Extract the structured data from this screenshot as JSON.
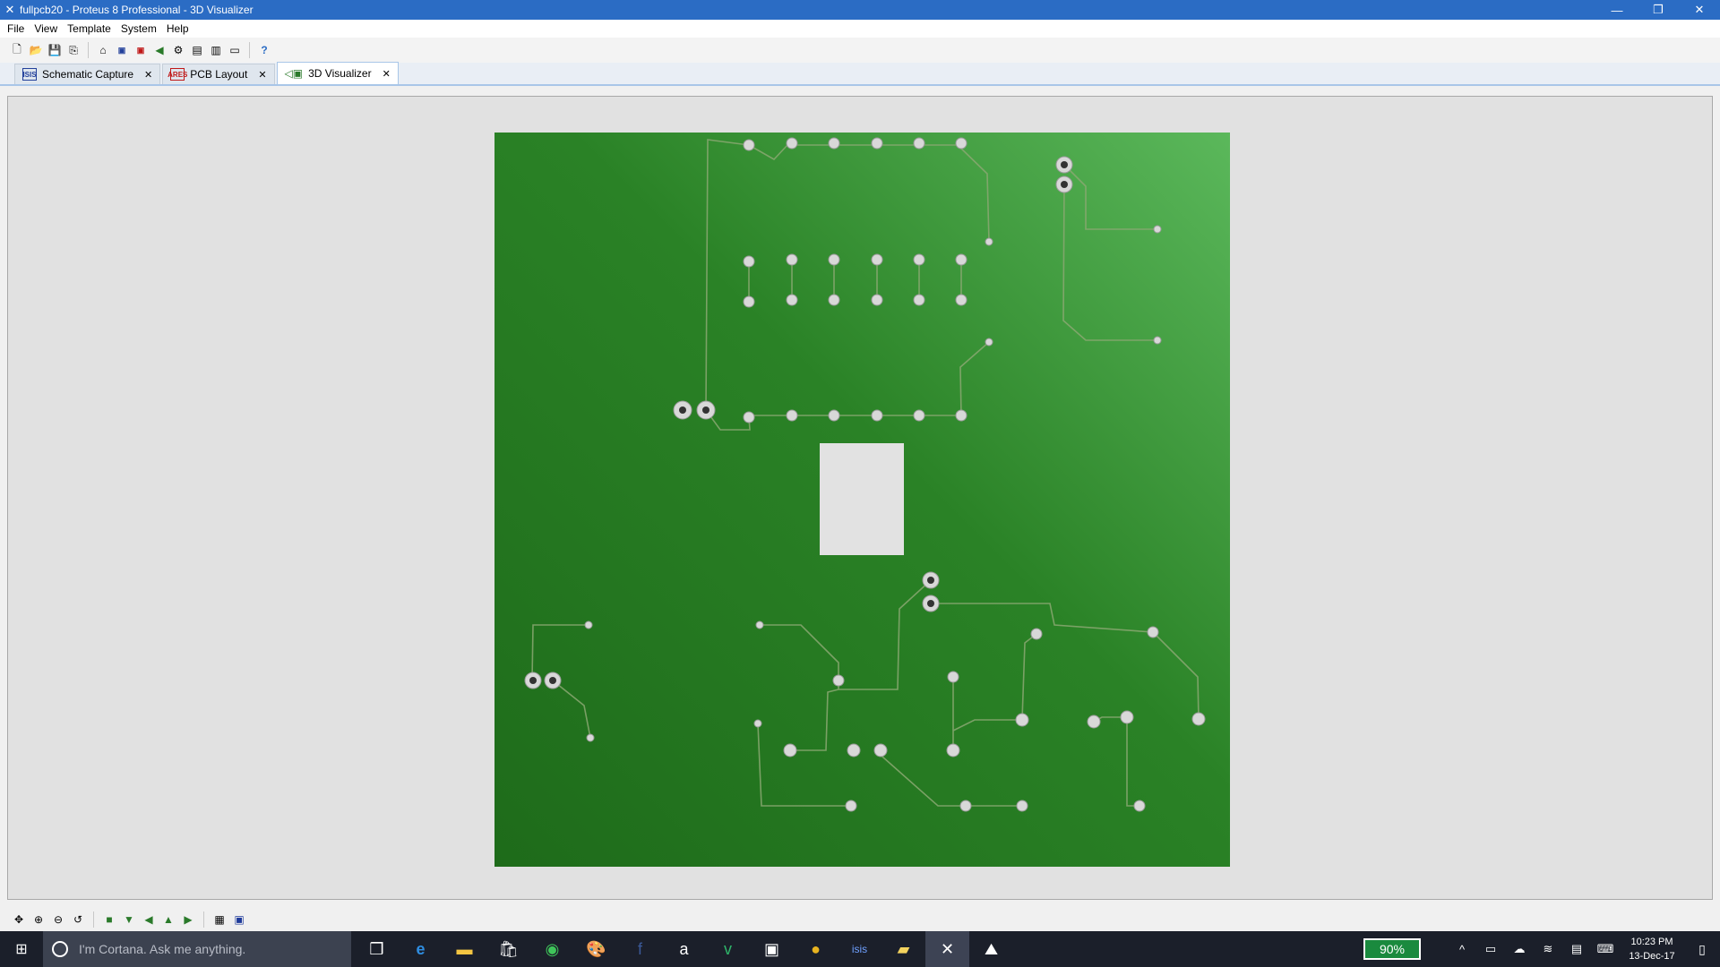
{
  "window": {
    "title": "fullpcb20 - Proteus 8 Professional - 3D Visualizer"
  },
  "menu": [
    "File",
    "View",
    "Template",
    "System",
    "Help"
  ],
  "tabs": [
    {
      "label": "Schematic Capture",
      "icon": "ISIS",
      "active": false
    },
    {
      "label": "PCB Layout",
      "icon": "ARES",
      "active": false
    },
    {
      "label": "3D Visualizer",
      "icon": "3D",
      "active": true
    }
  ],
  "taskbar": {
    "cortana_placeholder": "I'm Cortana. Ask me anything.",
    "battery": "90%",
    "time": "10:23 PM",
    "date": "13-Dec-17"
  },
  "colors": {
    "titlebar": "#2b6cc4",
    "board_dark": "#1e6b1a",
    "board_light": "#5bb85b",
    "taskbar": "#1b1f2a"
  }
}
